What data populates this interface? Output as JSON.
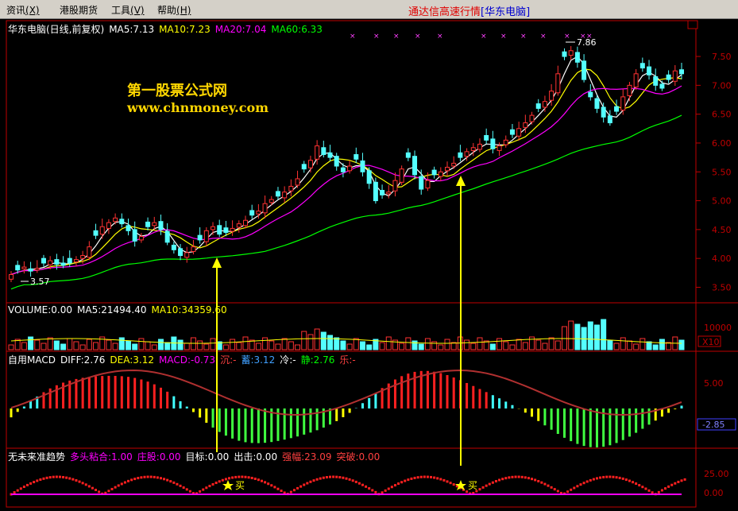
{
  "menu": {
    "items": [
      {
        "label": "资讯",
        "key": "(X)"
      },
      {
        "label": "港股期货",
        "key": ""
      },
      {
        "label": "工具",
        "key": "(V)"
      },
      {
        "label": "帮助",
        "key": "(H)"
      }
    ],
    "app_title": "通达信高速行情",
    "app_title_bracket": "[华东电脑]"
  },
  "colors": {
    "up": "#ff3232",
    "down": "#54ffff",
    "ma5": "#ffffff",
    "ma10": "#ffff00",
    "ma20": "#ff00ff",
    "ma60": "#00ff00",
    "axis": "#c00000",
    "arrow": "#ffff00"
  },
  "price_panel": {
    "title": "华东电脑(日线,前复权)",
    "ma5": "MA5:7.13",
    "ma10": "MA10:7.23",
    "ma20": "MA20:7.04",
    "ma60": "MA60:6.33",
    "high_label": "7.86",
    "low_label": "3.57",
    "y_ticks": [
      "7.50",
      "7.00",
      "6.50",
      "6.00",
      "5.50",
      "5.00",
      "4.50",
      "4.00",
      "3.50"
    ]
  },
  "watermark": {
    "line1": "第一股票公式网",
    "line2": "www.chnmoney.com"
  },
  "volume_panel": {
    "title": "VOLUME:0.00",
    "ma5": "MA5:21494.40",
    "ma10": "MA10:34359.60",
    "y_tick": "10000",
    "unit": "X10"
  },
  "macd_panel": {
    "title": "自用MACD",
    "diff": "DIFF:2.76",
    "dea": "DEA:3.12",
    "macd": "MACD:-0.73",
    "chen": "沉:-",
    "zhe": "蓄:3.12",
    "leng": "冷:-",
    "jing": "静:2.76",
    "le": "乐:-",
    "y_tick": "5.00",
    "current": "-2.85"
  },
  "trend_panel": {
    "title": "无未来准趋势",
    "multi": "多头粘合:1.00",
    "zhuang": "庄股:0.00",
    "target": "目标:0.00",
    "exit": "出击:0.00",
    "strength": "强幅:23.09",
    "breakout": "突破:0.00",
    "y_ticks": [
      "25.00",
      "0.00"
    ],
    "buy_label": "买"
  },
  "chart_data": {
    "type": "candlestick",
    "ylim": [
      3.3,
      7.9
    ],
    "closes": [
      3.72,
      3.8,
      3.85,
      3.78,
      3.83,
      3.92,
      3.96,
      3.9,
      3.88,
      3.92,
      3.98,
      4.05,
      4.2,
      4.4,
      4.55,
      4.62,
      4.7,
      4.6,
      4.48,
      4.3,
      4.38,
      4.55,
      4.62,
      4.5,
      4.28,
      4.15,
      4.05,
      4.1,
      4.2,
      4.32,
      4.48,
      4.55,
      4.42,
      4.45,
      4.52,
      4.6,
      4.66,
      4.75,
      4.82,
      4.95,
      5.02,
      5.08,
      5.15,
      5.25,
      5.38,
      5.55,
      5.7,
      5.95,
      5.8,
      5.75,
      5.6,
      5.5,
      5.6,
      5.72,
      5.5,
      5.3,
      5.0,
      5.1,
      5.15,
      5.35,
      5.55,
      5.75,
      5.45,
      5.2,
      5.35,
      5.45,
      5.5,
      5.58,
      5.65,
      5.75,
      5.85,
      5.92,
      5.98,
      6.05,
      5.9,
      5.95,
      6.05,
      6.15,
      6.25,
      6.35,
      6.48,
      6.6,
      6.72,
      6.9,
      7.2,
      7.5,
      7.6,
      7.4,
      7.1,
      6.8,
      6.6,
      6.45,
      6.35,
      6.55,
      6.8,
      7.0,
      7.2,
      7.3,
      7.18,
      7.0,
      6.95,
      7.1,
      7.25,
      7.2
    ]
  }
}
